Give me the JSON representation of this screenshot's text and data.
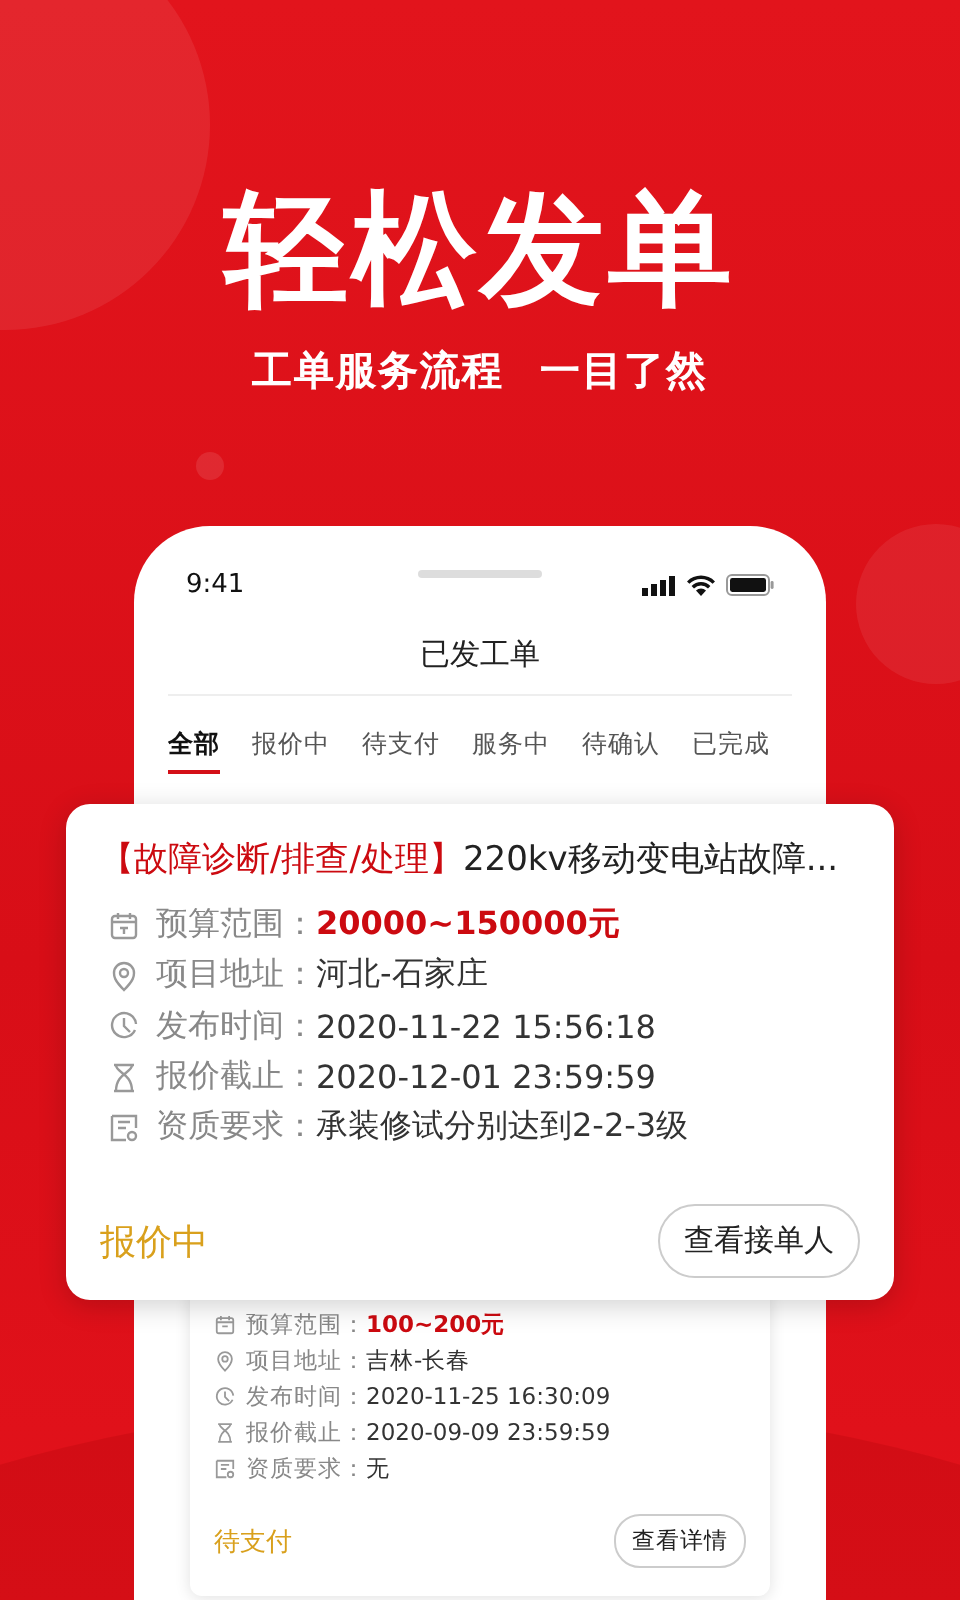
{
  "hero": {
    "title": "轻松发单",
    "subtitle": [
      "工单服务流程",
      "一目了然"
    ]
  },
  "phone": {
    "time": "9:41",
    "title": "已发工单",
    "tabs": [
      {
        "label": "全部",
        "selected": true
      },
      {
        "label": "报价中",
        "selected": false
      },
      {
        "label": "待支付",
        "selected": false
      },
      {
        "label": "服务中",
        "selected": false
      },
      {
        "label": "待确认",
        "selected": false
      },
      {
        "label": "已完成",
        "selected": false
      }
    ],
    "card": {
      "fields": [
        {
          "kind": "budget",
          "label": "预算范围：",
          "value": "100~200元"
        },
        {
          "kind": "address",
          "label": "项目地址：",
          "value": "吉林-长春"
        },
        {
          "kind": "time",
          "label": "发布时间：",
          "value": "2020-11-25 16:30:09"
        },
        {
          "kind": "deadline",
          "label": "报价截止：",
          "value": "2020-09-09 23:59:59"
        },
        {
          "kind": "qualification",
          "label": "资质要求：",
          "value": "无"
        }
      ],
      "status": "待支付",
      "button": "查看详情"
    }
  },
  "popup_card": {
    "category": "【故障诊断/排查/处理】",
    "title": "220kv移动变电站故障...",
    "fields": [
      {
        "kind": "budget",
        "label": "预算范围：",
        "value": "20000~150000元"
      },
      {
        "kind": "address",
        "label": "项目地址：",
        "value": "河北-石家庄"
      },
      {
        "kind": "time",
        "label": "发布时间：",
        "value": "2020-11-22 15:56:18"
      },
      {
        "kind": "deadline",
        "label": "报价截止：",
        "value": "2020-12-01 23:59:59"
      },
      {
        "kind": "qualification",
        "label": "资质要求：",
        "value": "承装修试分别达到2-2-3级"
      }
    ],
    "status": "报价中",
    "button": "查看接单人"
  }
}
